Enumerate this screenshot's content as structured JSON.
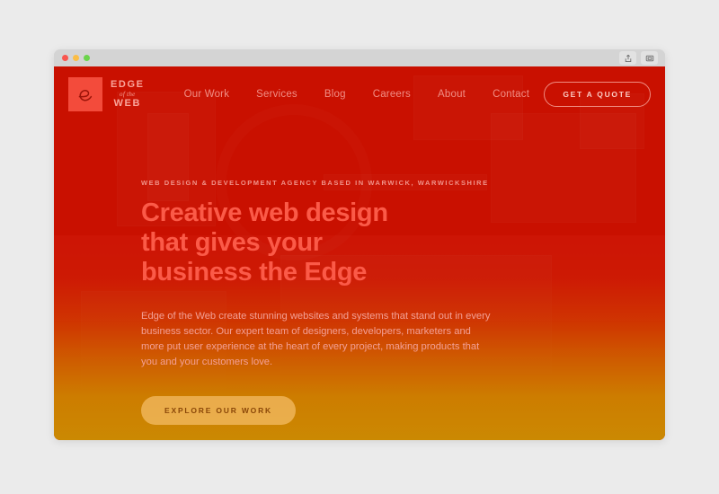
{
  "window": {
    "traffic_lights": [
      "close",
      "minimize",
      "maximize"
    ],
    "actions": [
      {
        "name": "share-icon",
        "label": "Share"
      },
      {
        "name": "tabs-icon",
        "label": "Tabs"
      }
    ]
  },
  "site": {
    "logo": {
      "mark_letter": "e",
      "line1": "EDGE",
      "line2": "of the",
      "line3": "WEB"
    },
    "nav": [
      {
        "label": "Our Work"
      },
      {
        "label": "Services"
      },
      {
        "label": "Blog"
      },
      {
        "label": "Careers"
      },
      {
        "label": "About"
      },
      {
        "label": "Contact"
      }
    ],
    "quote_button": "GET A QUOTE",
    "hero": {
      "eyebrow": "WEB DESIGN & DEVELOPMENT AGENCY BASED IN WARWICK, WARWICKSHIRE",
      "headline": "Creative web design that gives your business the Edge",
      "copy": "Edge of the Web create stunning websites and systems that stand out in every business sector. Our expert team of designers, developers, marketers and more put user experience at the heart of every project, making products that you and your customers love.",
      "cta": "EXPLORE OUR WORK"
    }
  },
  "colors": {
    "page_background": "#ebebeb",
    "titlebar": "#d4d4d4",
    "hero_red": "#cc1100",
    "hero_amber": "#cb8902",
    "headline": "#fb5a48",
    "logo_mark": "#f34b3b",
    "nav_link": "#f08e85",
    "cta_fill": "#ffcd82"
  }
}
